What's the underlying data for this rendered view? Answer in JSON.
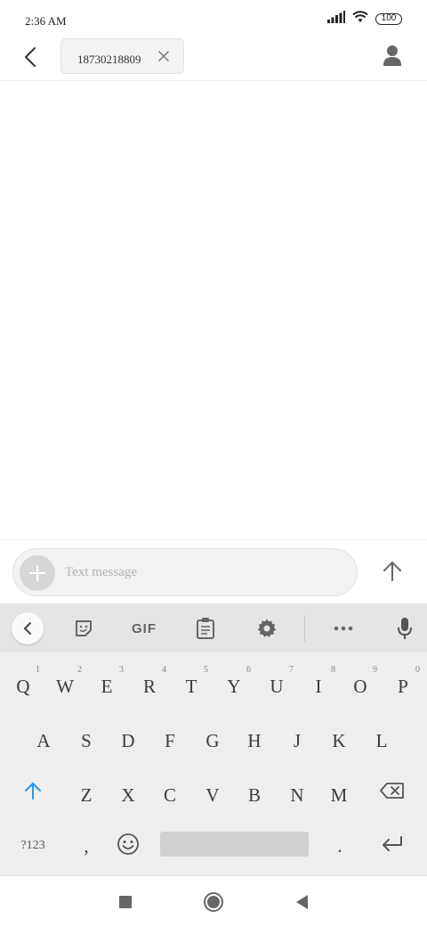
{
  "status_bar": {
    "time": "2:36 AM",
    "battery": "100",
    "icons": [
      "signal-icon",
      "wifi-icon",
      "battery-icon"
    ]
  },
  "header": {
    "recipient": "18730218809",
    "back_icon": "back-arrow-icon",
    "contact_icon": "contact-person-icon"
  },
  "composer": {
    "placeholder": "Text message",
    "value": ""
  },
  "keyboard": {
    "toolbar": {
      "gif_label": "GIF"
    },
    "rows": [
      [
        {
          "label": "Q",
          "hint": "1"
        },
        {
          "label": "W",
          "hint": "2"
        },
        {
          "label": "E",
          "hint": "3"
        },
        {
          "label": "R",
          "hint": "4"
        },
        {
          "label": "T",
          "hint": "5"
        },
        {
          "label": "Y",
          "hint": "6"
        },
        {
          "label": "U",
          "hint": "7"
        },
        {
          "label": "I",
          "hint": "8"
        },
        {
          "label": "O",
          "hint": "9"
        },
        {
          "label": "P",
          "hint": "0"
        }
      ],
      [
        {
          "label": "A"
        },
        {
          "label": "S"
        },
        {
          "label": "D"
        },
        {
          "label": "F"
        },
        {
          "label": "G"
        },
        {
          "label": "H"
        },
        {
          "label": "J"
        },
        {
          "label": "K"
        },
        {
          "label": "L"
        }
      ],
      [
        {
          "label": "Z"
        },
        {
          "label": "X"
        },
        {
          "label": "C"
        },
        {
          "label": "V"
        },
        {
          "label": "B"
        },
        {
          "label": "N"
        },
        {
          "label": "M"
        }
      ]
    ],
    "symbols_label": "?123",
    "comma_label": ",",
    "period_label": ".",
    "accent_color": "#2196f3"
  }
}
